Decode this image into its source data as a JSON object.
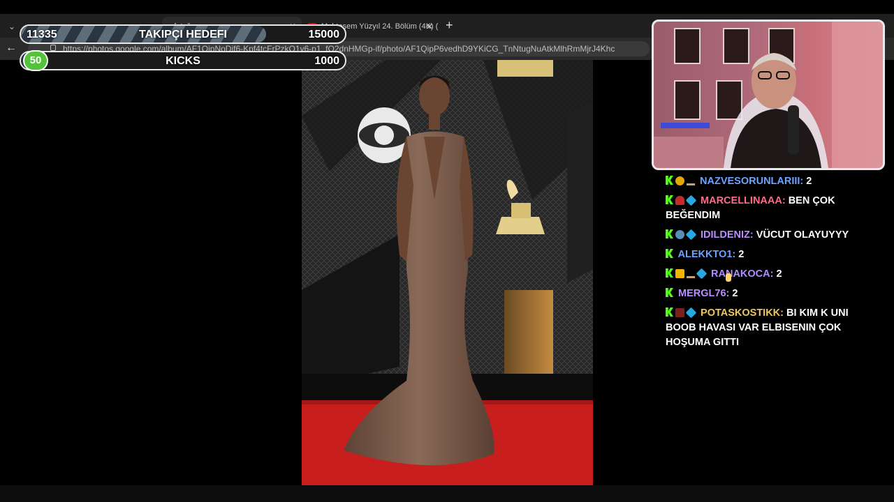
{
  "browser": {
    "tabs": [
      {
        "title": "n fotoğ"
      },
      {
        "title": "Muhteşem Yüzyıl 24. Bölüm (4K) (S"
      }
    ],
    "new_tab_label": "+",
    "url": "https://photos.google.com/album/AF1QipNoDif6-Kpf4tcFrPzkQ1y6-p1_fO2dnHMGp-if/photo/AF1QipP6vedhD9YKiCG_TnNtugNuAtkMlhRmMjrJ4Khc"
  },
  "overlay": {
    "follower_goal": {
      "current": "11335",
      "label": "TAKIPÇI HEDEFI",
      "target": "15000",
      "progress": 0.756
    },
    "kicks_goal": {
      "current": "50",
      "label": "KICKS",
      "target": "1000",
      "progress": 0.05
    }
  },
  "chat": {
    "messages": [
      {
        "username": "NAZVESORUNLARIII:",
        "text": "2",
        "color": "#6ea2ff"
      },
      {
        "username": "MARCELLINAAA:",
        "text": "BEN ÇOK BEĞENDIM",
        "color": "#ff6b87"
      },
      {
        "username": "IDILDENIZ:",
        "text": "VÜCUT OLAYUYYY",
        "color": "#b98cff"
      },
      {
        "username": "ALEKKTO1:",
        "text": "2",
        "color": "#6ea2ff"
      },
      {
        "username": "RANAKOCA:",
        "text": "2",
        "color": "#b08cff"
      },
      {
        "username": "MERGL76:",
        "text": "2",
        "color": "#b98cff"
      },
      {
        "username": "POTASKOSTIKK:",
        "text": "BI KIM K UNI BOOB HAVASI VAR ELBISENIN ÇOK HOŞUMA GITTI",
        "color": "#f0c85a"
      }
    ]
  }
}
